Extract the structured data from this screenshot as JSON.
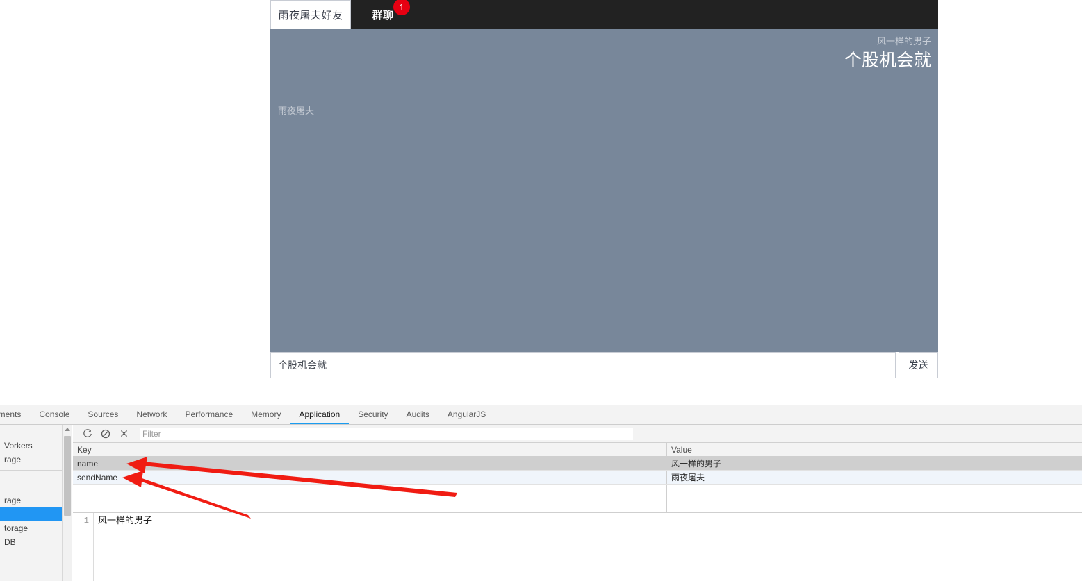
{
  "chat": {
    "tabs": [
      {
        "label": "雨夜屠夫好友",
        "active": true,
        "badge": null
      },
      {
        "label": "群聊",
        "active": false,
        "badge": "1"
      }
    ],
    "messages": [
      {
        "align": "right",
        "sender": "风一样的男子",
        "text": "个股机会就"
      },
      {
        "align": "left",
        "sender": "雨夜屠夫",
        "text": ""
      }
    ],
    "composer": {
      "value": "个股机会就",
      "placeholder": "",
      "send_label": "发送"
    },
    "background_color": "#78879a"
  },
  "devtools": {
    "tabs": [
      {
        "label": "ements",
        "active": false
      },
      {
        "label": "Console",
        "active": false
      },
      {
        "label": "Sources",
        "active": false
      },
      {
        "label": "Network",
        "active": false
      },
      {
        "label": "Performance",
        "active": false
      },
      {
        "label": "Memory",
        "active": false
      },
      {
        "label": "Application",
        "active": true
      },
      {
        "label": "Security",
        "active": false
      },
      {
        "label": "Audits",
        "active": false
      },
      {
        "label": "AngularJS",
        "active": false
      }
    ],
    "accent_color": "#1a9cf0",
    "sidebar": {
      "items": [
        {
          "label": "Vorkers",
          "selected": false
        },
        {
          "label": "rage",
          "selected": false
        },
        {
          "label": "rage",
          "selected": false
        },
        {
          "label": "",
          "selected": true
        },
        {
          "label": "torage",
          "selected": false
        },
        {
          "label": "DB",
          "selected": false
        }
      ]
    },
    "toolbar": {
      "refresh_title": "Refresh",
      "clear_title": "Clear",
      "delete_title": "Delete Selected",
      "filter_placeholder": "Filter",
      "filter_value": ""
    },
    "storage_table": {
      "columns": [
        "Key",
        "Value"
      ],
      "rows": [
        {
          "key": "name",
          "value": "风一样的男子",
          "selected": true
        },
        {
          "key": "sendName",
          "value": "雨夜屠夫",
          "selected": false
        }
      ]
    },
    "preview": {
      "line_number": "1",
      "content": "风一样的男子"
    }
  },
  "annotations": {
    "arrow_color": "#f01c13",
    "arrows": [
      {
        "target": "name-row"
      },
      {
        "target": "sendName-row"
      }
    ]
  }
}
